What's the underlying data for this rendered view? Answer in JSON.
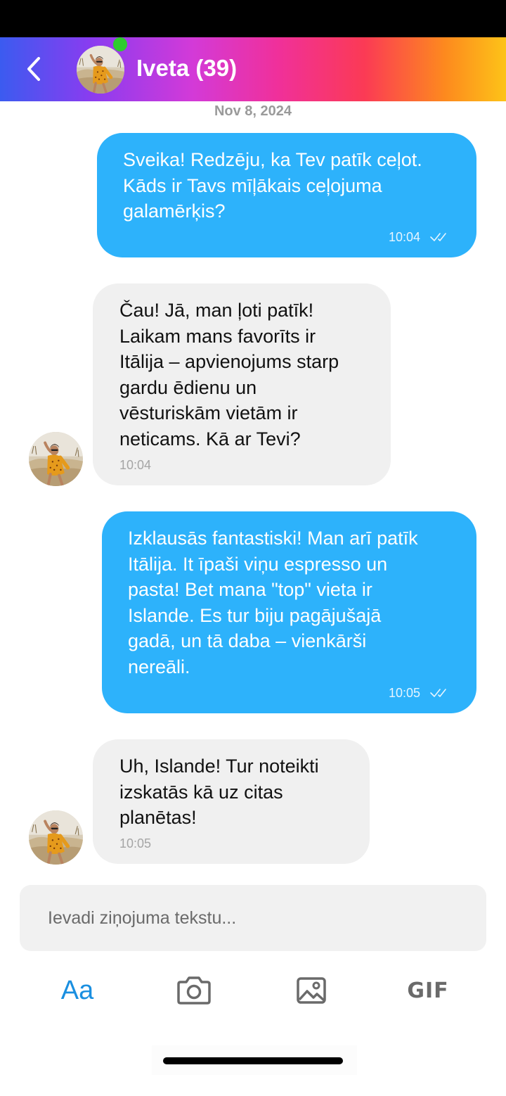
{
  "header": {
    "contact_name": "Iveta (39)",
    "online": true,
    "colors": {
      "gradient_start": "#3b5bf0",
      "gradient_mid": "#f0309a",
      "gradient_end": "#fdc318",
      "online_dot": "#2ecc2e"
    }
  },
  "conversation": {
    "date": "Nov 8, 2024",
    "messages": [
      {
        "direction": "outgoing",
        "text": "Sveika! Redzēju, ka Tev patīk ceļot.\nKāds ir Tavs mīļākais ceļojuma\ngalamērķis?",
        "time": "10:04",
        "status": "read",
        "status_icon": "double-check-icon"
      },
      {
        "direction": "incoming",
        "text": "Čau! Jā, man ļoti patīk!\nLaikam mans favorīts ir\nItālija – apvienojums starp\ngardu ēdienu un\nvēsturiskām vietām ir\nneticams. Kā ar Tevi?",
        "time": "10:04"
      },
      {
        "direction": "outgoing",
        "text": "Izklausās fantastiski! Man arī patīk\nItālija. It īpaši viņu espresso un\npasta! Bet mana \"top\" vieta ir\nIslande. Es tur biju pagājušajā\ngadā, un tā daba – vienkārši\nnereāli.",
        "time": "10:05",
        "status": "read",
        "status_icon": "double-check-icon"
      },
      {
        "direction": "incoming",
        "text": "Uh, Islande! Tur noteikti\nizskatās kā uz citas\nplanētas!",
        "time": "10:05"
      }
    ],
    "colors": {
      "outgoing_bubble": "#2db2fb",
      "incoming_bubble": "#f0f0f0"
    }
  },
  "composer": {
    "placeholder": "Ievadi ziņojuma tekstu...",
    "value": ""
  },
  "toolbar": {
    "text_mode_label": "Aa",
    "camera_icon": "camera-icon",
    "gallery_icon": "image-icon",
    "gif_label": "GIF",
    "accent_color": "#1a8fe0"
  }
}
